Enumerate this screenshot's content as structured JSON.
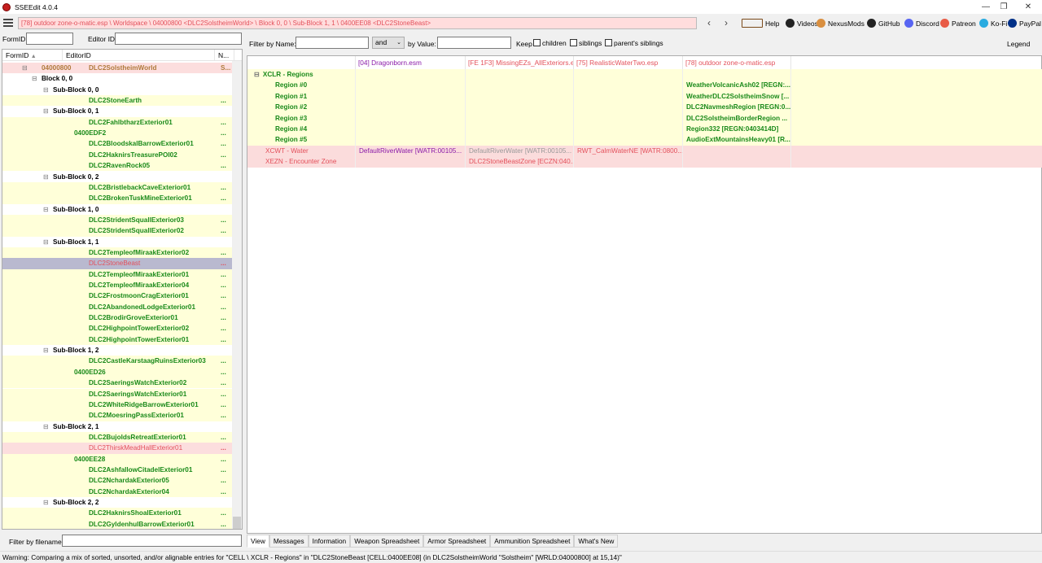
{
  "window": {
    "title": "SSEEdit 4.0.4",
    "min": "—",
    "restore": "❐",
    "close": "✕"
  },
  "path": "[78] outdoor zone-o-matic.esp \\ Worldspace \\ 04000800 <DLC2SolstheimWorld> \\ Block 0, 0 \\ Sub-Block 1, 1 \\ 0400EE08 <DLC2StoneBeast>",
  "nav": {
    "back": "‹",
    "forward": "›"
  },
  "toolbar": [
    {
      "label": "Help",
      "icon": "book-icon",
      "color": "#7b4a1a"
    },
    {
      "label": "Videos",
      "icon": "film-icon",
      "color": "#222"
    },
    {
      "label": "NexusMods",
      "icon": "nexus-icon",
      "color": "#d98f40"
    },
    {
      "label": "GitHub",
      "icon": "github-icon",
      "color": "#222"
    },
    {
      "label": "Discord",
      "icon": "discord-icon",
      "color": "#5865f2"
    },
    {
      "label": "Patreon",
      "icon": "patreon-icon",
      "color": "#e85b46"
    },
    {
      "label": "Ko-Fi",
      "icon": "kofi-icon",
      "color": "#29abe0"
    },
    {
      "label": "PayPal",
      "icon": "paypal-icon",
      "color": "#003087"
    }
  ],
  "left": {
    "formid_label": "FormID",
    "editorid_label": "Editor ID",
    "formid_value": "",
    "editorid_value": "",
    "columns": [
      "FormID",
      "EditorID",
      "N..."
    ],
    "sort_arrow": "▲",
    "filter_label": "Filter by filename:",
    "filter_value": ""
  },
  "tree": [
    {
      "fid": "04000800",
      "eid": "DLC2SolstheimWorld",
      "dots": "S...",
      "indent": 0,
      "type": "world",
      "expander": "⊟"
    },
    {
      "fid": "",
      "eid": "Block 0, 0",
      "dots": "",
      "indent": 1,
      "type": "block",
      "expander": "⊟"
    },
    {
      "fid": "",
      "eid": "Sub-Block 0, 0",
      "dots": "",
      "indent": 2,
      "type": "block",
      "expander": "⊟"
    },
    {
      "fid": "",
      "eid": "DLC2StoneEarth",
      "dots": "...",
      "indent": 3,
      "type": "cell"
    },
    {
      "fid": "",
      "eid": "Sub-Block 0, 1",
      "dots": "",
      "indent": 2,
      "type": "block",
      "expander": "⊟"
    },
    {
      "fid": "",
      "eid": "DLC2FahlbtharzExterior01",
      "dots": "...",
      "indent": 3,
      "type": "cell"
    },
    {
      "fid": "0400EDF2",
      "eid": "",
      "dots": "...",
      "indent": 3,
      "type": "cellid"
    },
    {
      "fid": "",
      "eid": "DLC2BloodskalBarrowExterior01",
      "dots": "...",
      "indent": 3,
      "type": "cell"
    },
    {
      "fid": "",
      "eid": "DLC2HaknirsTreasurePOI02",
      "dots": "...",
      "indent": 3,
      "type": "cell"
    },
    {
      "fid": "",
      "eid": "DLC2RavenRock05",
      "dots": "...",
      "indent": 3,
      "type": "cell"
    },
    {
      "fid": "",
      "eid": "Sub-Block 0, 2",
      "dots": "",
      "indent": 2,
      "type": "block",
      "expander": "⊟"
    },
    {
      "fid": "",
      "eid": "DLC2BristlebackCaveExterior01",
      "dots": "...",
      "indent": 3,
      "type": "cell"
    },
    {
      "fid": "",
      "eid": "DLC2BrokenTuskMineExterior01",
      "dots": "...",
      "indent": 3,
      "type": "cell"
    },
    {
      "fid": "",
      "eid": "Sub-Block 1, 0",
      "dots": "",
      "indent": 2,
      "type": "block",
      "expander": "⊟"
    },
    {
      "fid": "",
      "eid": "DLC2StridentSquallExterior03",
      "dots": "...",
      "indent": 3,
      "type": "cell"
    },
    {
      "fid": "",
      "eid": "DLC2StridentSquallExterior02",
      "dots": "...",
      "indent": 3,
      "type": "cell"
    },
    {
      "fid": "",
      "eid": "Sub-Block 1, 1",
      "dots": "",
      "indent": 2,
      "type": "block",
      "expander": "⊟"
    },
    {
      "fid": "",
      "eid": "DLC2TempleofMiraakExterior02",
      "dots": "...",
      "indent": 3,
      "type": "cell"
    },
    {
      "fid": "",
      "eid": "DLC2StoneBeast",
      "dots": "...",
      "indent": 3,
      "type": "selected"
    },
    {
      "fid": "",
      "eid": "DLC2TempleofMiraakExterior01",
      "dots": "...",
      "indent": 3,
      "type": "cell"
    },
    {
      "fid": "",
      "eid": "DLC2TempleofMiraakExterior04",
      "dots": "...",
      "indent": 3,
      "type": "cell"
    },
    {
      "fid": "",
      "eid": "DLC2FrostmoonCragExterior01",
      "dots": "...",
      "indent": 3,
      "type": "cell"
    },
    {
      "fid": "",
      "eid": "DLC2AbandonedLodgeExterior01",
      "dots": "...",
      "indent": 3,
      "type": "cell"
    },
    {
      "fid": "",
      "eid": "DLC2BrodirGroveExterior01",
      "dots": "...",
      "indent": 3,
      "type": "cell"
    },
    {
      "fid": "",
      "eid": "DLC2HighpointTowerExterior02",
      "dots": "...",
      "indent": 3,
      "type": "cell"
    },
    {
      "fid": "",
      "eid": "DLC2HighpointTowerExterior01",
      "dots": "...",
      "indent": 3,
      "type": "cell"
    },
    {
      "fid": "",
      "eid": "Sub-Block 1, 2",
      "dots": "",
      "indent": 2,
      "type": "block",
      "expander": "⊟"
    },
    {
      "fid": "",
      "eid": "DLC2CastleKarstaagRuinsExterior03",
      "dots": "...",
      "indent": 3,
      "type": "cell"
    },
    {
      "fid": "0400ED26",
      "eid": "",
      "dots": "...",
      "indent": 3,
      "type": "cellid"
    },
    {
      "fid": "",
      "eid": "DLC2SaeringsWatchExterior02",
      "dots": "...",
      "indent": 3,
      "type": "cell"
    },
    {
      "fid": "",
      "eid": "DLC2SaeringsWatchExterior01",
      "dots": "...",
      "indent": 3,
      "type": "cell"
    },
    {
      "fid": "",
      "eid": "DLC2WhiteRidgeBarrowExterior01",
      "dots": "...",
      "indent": 3,
      "type": "cell"
    },
    {
      "fid": "",
      "eid": "DLC2MoesringPassExterior01",
      "dots": "...",
      "indent": 3,
      "type": "cell"
    },
    {
      "fid": "",
      "eid": "Sub-Block 2, 1",
      "dots": "",
      "indent": 2,
      "type": "block",
      "expander": "⊟"
    },
    {
      "fid": "",
      "eid": "DLC2BujoldsRetreatExterior01",
      "dots": "...",
      "indent": 3,
      "type": "cell"
    },
    {
      "fid": "",
      "eid": "DLC2ThirskMeadHallExterior01",
      "dots": "...",
      "indent": 3,
      "type": "conflict"
    },
    {
      "fid": "0400EE28",
      "eid": "",
      "dots": "...",
      "indent": 3,
      "type": "cellid"
    },
    {
      "fid": "",
      "eid": "DLC2AshfallowCitadelExterior01",
      "dots": "...",
      "indent": 3,
      "type": "cell"
    },
    {
      "fid": "",
      "eid": "DLC2NchardakExterior05",
      "dots": "...",
      "indent": 3,
      "type": "cell"
    },
    {
      "fid": "",
      "eid": "DLC2NchardakExterior04",
      "dots": "...",
      "indent": 3,
      "type": "cell"
    },
    {
      "fid": "",
      "eid": "Sub-Block 2, 2",
      "dots": "",
      "indent": 2,
      "type": "block",
      "expander": "⊟"
    },
    {
      "fid": "",
      "eid": "DLC2HaknirsShoalExterior01",
      "dots": "...",
      "indent": 3,
      "type": "cell"
    },
    {
      "fid": "",
      "eid": "DLC2GyldenhulBarrowExterior01",
      "dots": "...",
      "indent": 3,
      "type": "cell"
    }
  ],
  "filter": {
    "name_label": "Filter by Name:",
    "name_value": "",
    "op": "and",
    "value_label": "by Value:",
    "value_value": "",
    "keep": "Keep",
    "children": "children",
    "siblings": "siblings",
    "parents": "parent's siblings",
    "legend": "Legend"
  },
  "view": {
    "columns": [
      "",
      "[04] Dragonborn.esm",
      "[FE 1F3] MissingEZs_AllExteriors.esp",
      "[75] RealisticWaterTwo.esp",
      "[78] outdoor zone-o-matic.esp"
    ],
    "column_colors": [
      "#000",
      "#8a1aa8",
      "#e3505b",
      "#e3505b",
      "#e3505b"
    ],
    "rows": [
      {
        "label": "XCLR - Regions",
        "expander": "⊟",
        "bg": "#ffffd9",
        "color": "#1a8a1a",
        "cells": [
          "",
          "",
          "",
          ""
        ],
        "cellcolors": [
          "",
          "",
          "",
          ""
        ]
      },
      {
        "label": "Region #0",
        "bg": "#ffffd9",
        "color": "#1a8a1a",
        "cells": [
          "",
          "",
          "",
          "WeatherVolcanicAsh02 [REGN:..."
        ],
        "cellcolors": [
          "",
          "",
          "",
          "#1a8a1a"
        ]
      },
      {
        "label": "Region #1",
        "bg": "#ffffd9",
        "color": "#1a8a1a",
        "cells": [
          "",
          "",
          "",
          "WeatherDLC2SolstheimSnow [..."
        ],
        "cellcolors": [
          "",
          "",
          "",
          "#1a8a1a"
        ]
      },
      {
        "label": "Region #2",
        "bg": "#ffffd9",
        "color": "#1a8a1a",
        "cells": [
          "",
          "",
          "",
          "DLC2NavmeshRegion [REGN:0..."
        ],
        "cellcolors": [
          "",
          "",
          "",
          "#1a8a1a"
        ]
      },
      {
        "label": "Region #3",
        "bg": "#ffffd9",
        "color": "#1a8a1a",
        "cells": [
          "",
          "",
          "",
          "DLC2SolstheimBorderRegion ..."
        ],
        "cellcolors": [
          "",
          "",
          "",
          "#1a8a1a"
        ]
      },
      {
        "label": "Region #4",
        "bg": "#ffffd9",
        "color": "#1a8a1a",
        "cells": [
          "",
          "",
          "",
          "Region332 [REGN:0403414D]"
        ],
        "cellcolors": [
          "",
          "",
          "",
          "#1a8a1a"
        ]
      },
      {
        "label": "Region #5",
        "bg": "#ffffd9",
        "color": "#1a8a1a",
        "cells": [
          "",
          "",
          "",
          "AudioExtMountainsHeavy01 [R..."
        ],
        "cellcolors": [
          "",
          "",
          "",
          "#1a8a1a"
        ]
      },
      {
        "label": "XCWT - Water",
        "bg": "#fbdcdc",
        "color": "#e3505b",
        "cells": [
          "DefaultRiverWater [WATR:00105...",
          "DefaultRiverWater [WATR:00105...",
          "RWT_CalmWaterNE [WATR:0800...",
          ""
        ],
        "cellcolors": [
          "#8a1aa8",
          "#999",
          "#e3505b",
          ""
        ]
      },
      {
        "label": "XEZN - Encounter Zone",
        "bg": "#fbdcdc",
        "color": "#e3505b",
        "cells": [
          "",
          "DLC2StoneBeastZone [ECZN:040...",
          "",
          ""
        ],
        "cellcolors": [
          "",
          "#e3505b",
          "",
          ""
        ]
      }
    ]
  },
  "tabs": [
    "View",
    "Messages",
    "Information",
    "Weapon Spreadsheet",
    "Armor Spreadsheet",
    "Ammunition Spreadsheet",
    "What's New"
  ],
  "status": "Warning: Comparing a mix of sorted, unsorted, and/or alignable entries for \"CELL \\ XCLR - Regions\" in \"DLC2StoneBeast [CELL:0400EE08] (in DLC2SolstheimWorld \"Solstheim\" [WRLD:04000800] at 15,14)\""
}
